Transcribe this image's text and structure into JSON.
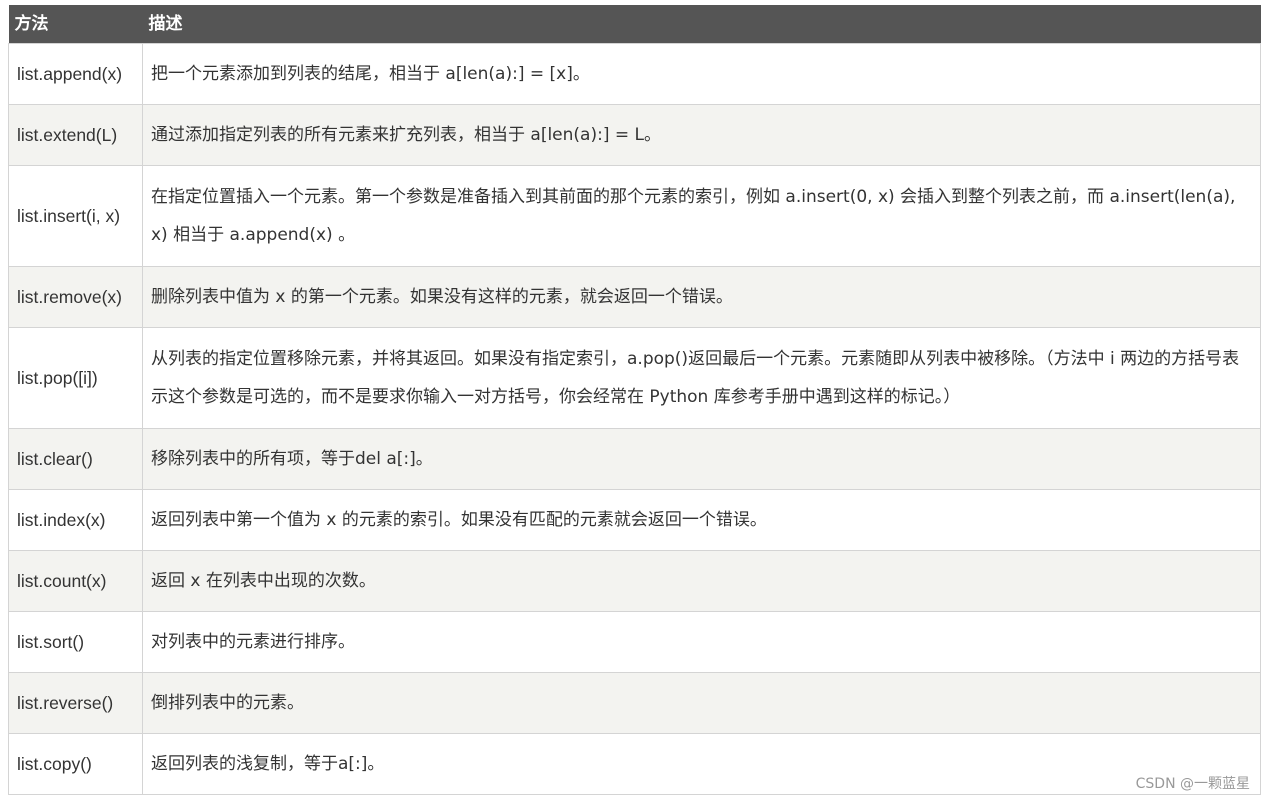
{
  "header": {
    "method_label": "方法",
    "desc_label": "描述"
  },
  "rows": [
    {
      "method": "list.append(x)",
      "desc": "把一个元素添加到列表的结尾，相当于 a[len(a):] = [x]。"
    },
    {
      "method": "list.extend(L)",
      "desc": "通过添加指定列表的所有元素来扩充列表，相当于 a[len(a):] = L。"
    },
    {
      "method": "list.insert(i, x)",
      "desc": "在指定位置插入一个元素。第一个参数是准备插入到其前面的那个元素的索引，例如 a.insert(0, x) 会插入到整个列表之前，而 a.insert(len(a), x) 相当于 a.append(x) 。"
    },
    {
      "method": "list.remove(x)",
      "desc": "删除列表中值为 x 的第一个元素。如果没有这样的元素，就会返回一个错误。"
    },
    {
      "method": "list.pop([i])",
      "desc": "从列表的指定位置移除元素，并将其返回。如果没有指定索引，a.pop()返回最后一个元素。元素随即从列表中被移除。（方法中 i 两边的方括号表示这个参数是可选的，而不是要求你输入一对方括号，你会经常在 Python 库参考手册中遇到这样的标记。）"
    },
    {
      "method": "list.clear()",
      "desc": "移除列表中的所有项，等于del a[:]。"
    },
    {
      "method": "list.index(x)",
      "desc": "返回列表中第一个值为 x 的元素的索引。如果没有匹配的元素就会返回一个错误。"
    },
    {
      "method": "list.count(x)",
      "desc": "返回 x 在列表中出现的次数。"
    },
    {
      "method": "list.sort()",
      "desc": "对列表中的元素进行排序。"
    },
    {
      "method": "list.reverse()",
      "desc": "倒排列表中的元素。"
    },
    {
      "method": "list.copy()",
      "desc": "返回列表的浅复制，等于a[:]。"
    }
  ],
  "watermark": "CSDN @一颗蓝星"
}
